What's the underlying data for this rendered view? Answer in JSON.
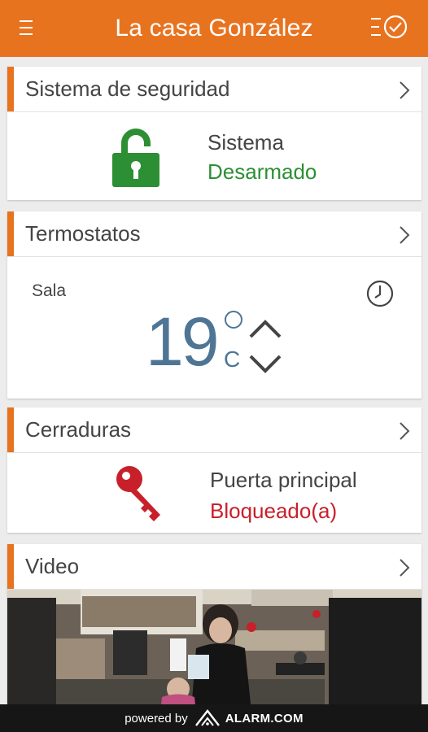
{
  "header": {
    "title": "La casa González",
    "menu_icon": "hamburger-menu-icon",
    "history_icon": "history-clock-icon",
    "bg_color": "#e8731f"
  },
  "security": {
    "title": "Sistema de seguridad",
    "label": "Sistema",
    "status": "Desarmado",
    "status_color": "#2d8f34",
    "icon": "unlocked-padlock-icon"
  },
  "thermostat": {
    "title": "Termostatos",
    "room": "Sala",
    "temperature": "19",
    "unit": "C",
    "icon": "schedule-clock-icon"
  },
  "locks": {
    "title": "Cerraduras",
    "label": "Puerta principal",
    "status": "Bloqueado(a)",
    "status_color": "#c8202a",
    "icon": "key-icon"
  },
  "video": {
    "title": "Video"
  },
  "footer": {
    "powered_by": "powered by",
    "brand": "ALARM.COM"
  }
}
